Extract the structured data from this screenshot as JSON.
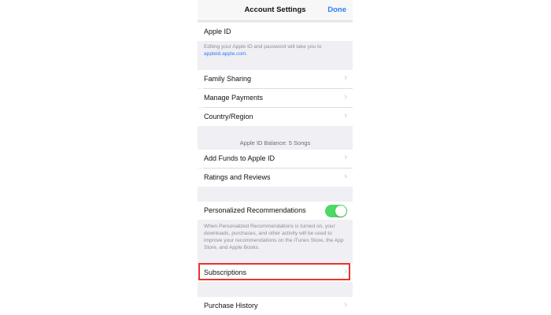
{
  "nav": {
    "title": "Account Settings",
    "done_label": "Done"
  },
  "apple_id": {
    "label": "Apple ID",
    "footer_text": "Editing your Apple ID and password will take you to",
    "footer_link": "appleid.apple.com",
    "footer_end": "."
  },
  "group1": {
    "family_sharing": "Family Sharing",
    "manage_payments": "Manage Payments",
    "country_region": "Country/Region"
  },
  "balance": {
    "header": "Apple ID Balance: 5 Songs",
    "add_funds": "Add Funds to Apple ID",
    "ratings_reviews": "Ratings and Reviews"
  },
  "recommendations": {
    "label": "Personalized Recommendations",
    "enabled": true,
    "footer": "When Personalized Recommendations is turned on, your downloads, purchases, and other activity will be used to improve your recommendations on the iTunes Store, the App Store, and Apple Books."
  },
  "subscriptions": {
    "label": "Subscriptions"
  },
  "purchase_history": {
    "label": "Purchase History"
  },
  "chevron": "›",
  "colors": {
    "accent": "#2f7cf6",
    "toggle_on": "#4cd964",
    "highlight": "#e8352a",
    "group_bg": "#efeff4"
  }
}
